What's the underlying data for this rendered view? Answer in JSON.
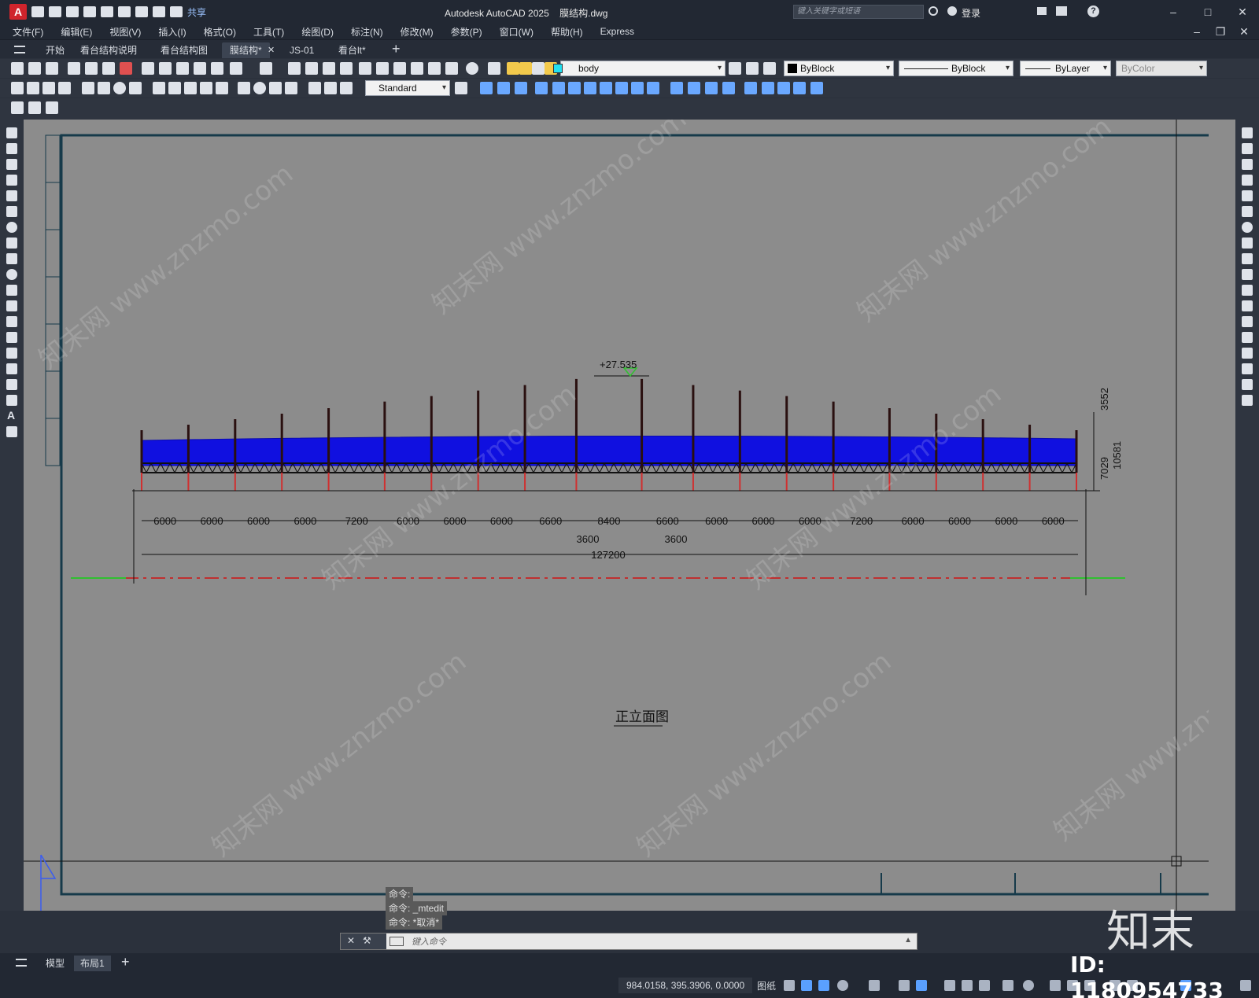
{
  "titlebar": {
    "app_title": "Autodesk AutoCAD 2025",
    "file_name": "膜结构.dwg",
    "share_label": "共享",
    "search_placeholder": "键入关键字或短语",
    "login_label": "登录"
  },
  "menu": [
    "文件(F)",
    "编辑(E)",
    "视图(V)",
    "插入(I)",
    "格式(O)",
    "工具(T)",
    "绘图(D)",
    "标注(N)",
    "修改(M)",
    "参数(P)",
    "窗口(W)",
    "帮助(H)",
    "Express"
  ],
  "tabs": [
    {
      "label": "开始"
    },
    {
      "label": "看台结构说明"
    },
    {
      "label": "看台结构图"
    },
    {
      "label": "膜结构*"
    },
    {
      "label": "JS-01"
    },
    {
      "label": "看台lt*"
    }
  ],
  "layer_combo": "body",
  "color_combo": "ByBlock",
  "linetype_combo": "ByBlock",
  "lineweight_combo": "ByLayer",
  "plotstyle_combo": "ByColor",
  "textstyle_combo": "Standard",
  "drawing": {
    "elevation_label": "+27.535",
    "view_title": "正立面图",
    "dims_top_row": [
      "6000",
      "6000",
      "6000",
      "6000",
      "7200",
      "6000",
      "6000",
      "6000",
      "6600",
      "8400",
      "6600",
      "6000",
      "6000",
      "6000",
      "7200",
      "6000",
      "6000",
      "6000",
      "6000"
    ],
    "dims_sub": [
      "3600",
      "3600"
    ],
    "dim_total": "127200",
    "dims_vertical": [
      "3552",
      "7029",
      "10581"
    ]
  },
  "command": {
    "history": [
      "命令:",
      "命令: _mtedit",
      "命令: *取消*"
    ],
    "placeholder": "键入命令"
  },
  "layout_tabs": [
    {
      "label": "模型"
    },
    {
      "label": "布局1"
    }
  ],
  "status": {
    "coords": "984.0158, 395.3906, 0.0000",
    "paper_label": "图纸"
  },
  "watermark": {
    "id_label": "ID: 1180954733",
    "brand": "知末",
    "site_text": "知末网 www.znzmo.com"
  },
  "colors": {
    "membrane": "#1010e0",
    "truss": "#111111",
    "canvas": "#8c8c8c",
    "frame": "#163a4a"
  }
}
